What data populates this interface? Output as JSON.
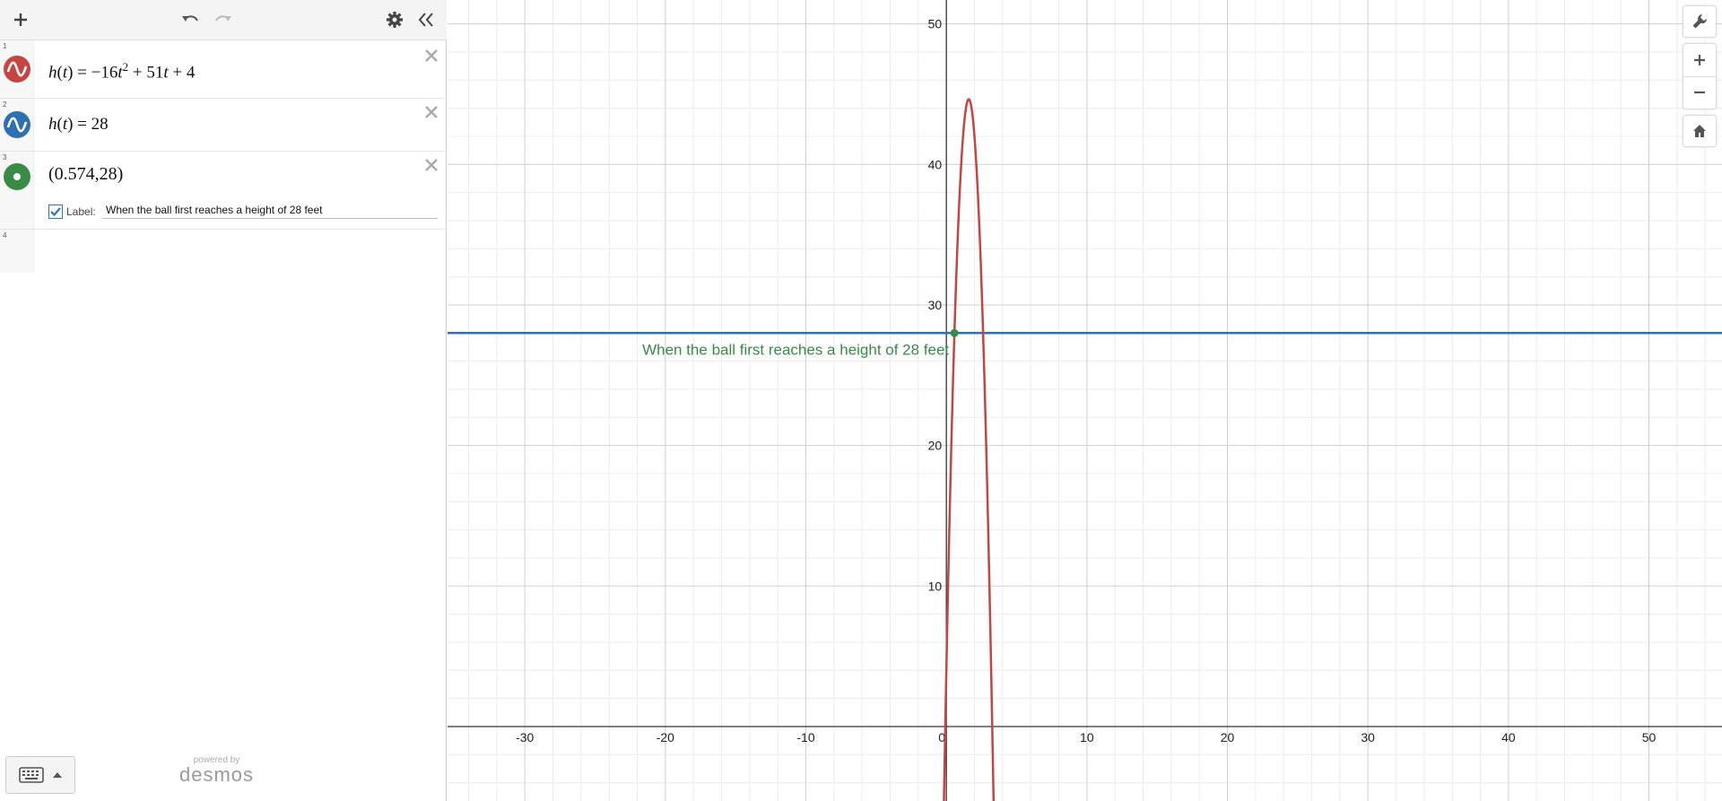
{
  "toolbar": {
    "add_icon": "plus-icon",
    "undo_icon": "undo-icon",
    "redo_icon": "redo-icon",
    "settings_icon": "gear-icon",
    "collapse_icon": "double-chevron-left-icon"
  },
  "expressions": [
    {
      "number": "1",
      "latex_text": "h(t) = −16t² + 51t + 4",
      "color": "#c74440",
      "kind": "curve"
    },
    {
      "number": "2",
      "latex_text": "h(t) = 28",
      "color": "#2d70b3",
      "kind": "curve"
    },
    {
      "number": "3",
      "latex_text": "(0.574,28)",
      "color": "#388c46",
      "kind": "point",
      "label_checkbox_text": "Label:",
      "label_checked": true,
      "label_value": "When the ball first reaches a height of 28 feet"
    },
    {
      "number": "4",
      "latex_text": "",
      "kind": "empty"
    }
  ],
  "footer": {
    "keyboard_icon": "keyboard-icon",
    "powered_by": "powered by",
    "brand": "desmos"
  },
  "graph": {
    "x_ticks": [
      "-30",
      "-20",
      "-10",
      "0",
      "10",
      "20",
      "30",
      "40",
      "50"
    ],
    "y_ticks": [
      "10",
      "20",
      "30",
      "40",
      "50"
    ],
    "point_label": "When the ball first reaches a height of 28 feet",
    "curve_color": "#c74440",
    "line_color": "#2d70b3",
    "point_color": "#388c46",
    "x_range": [
      -35.5,
      55.2
    ],
    "y_range": [
      -5.3,
      51.7
    ],
    "parabola": {
      "a": -16,
      "b": 51,
      "c": 4
    },
    "horizontal_line_y": 28,
    "point": {
      "x": 0.574,
      "y": 28
    }
  },
  "controls": {
    "wrench_icon": "wrench-icon",
    "zoom_in_icon": "plus-icon",
    "zoom_out_icon": "minus-icon",
    "home_icon": "home-icon"
  }
}
